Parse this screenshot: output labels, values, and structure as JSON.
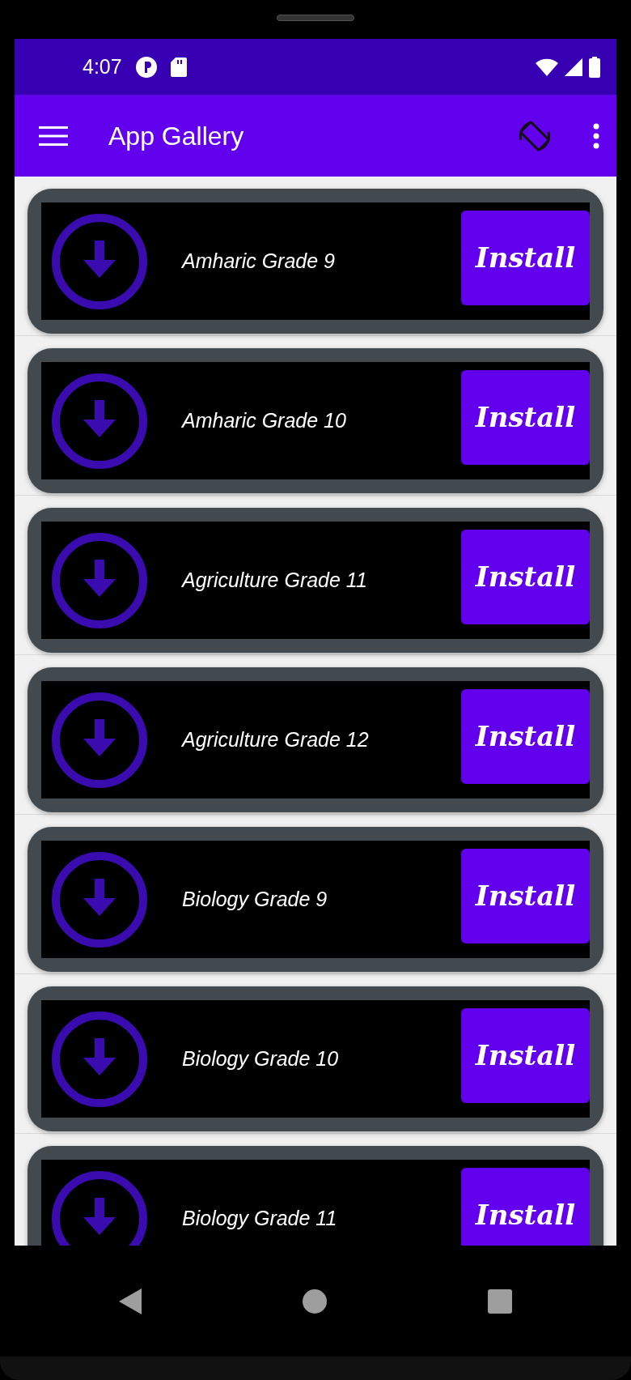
{
  "status_bar": {
    "time": "4:07"
  },
  "app_bar": {
    "title": "App Gallery"
  },
  "apps": [
    {
      "name": "Amharic Grade 9",
      "button": "Install"
    },
    {
      "name": "Amharic Grade 10",
      "button": "Install"
    },
    {
      "name": "Agriculture Grade 11",
      "button": "Install"
    },
    {
      "name": "Agriculture Grade 12",
      "button": "Install"
    },
    {
      "name": "Biology Grade 9",
      "button": "Install"
    },
    {
      "name": "Biology Grade 10",
      "button": "Install"
    },
    {
      "name": "Biology Grade 11",
      "button": "Install"
    }
  ]
}
